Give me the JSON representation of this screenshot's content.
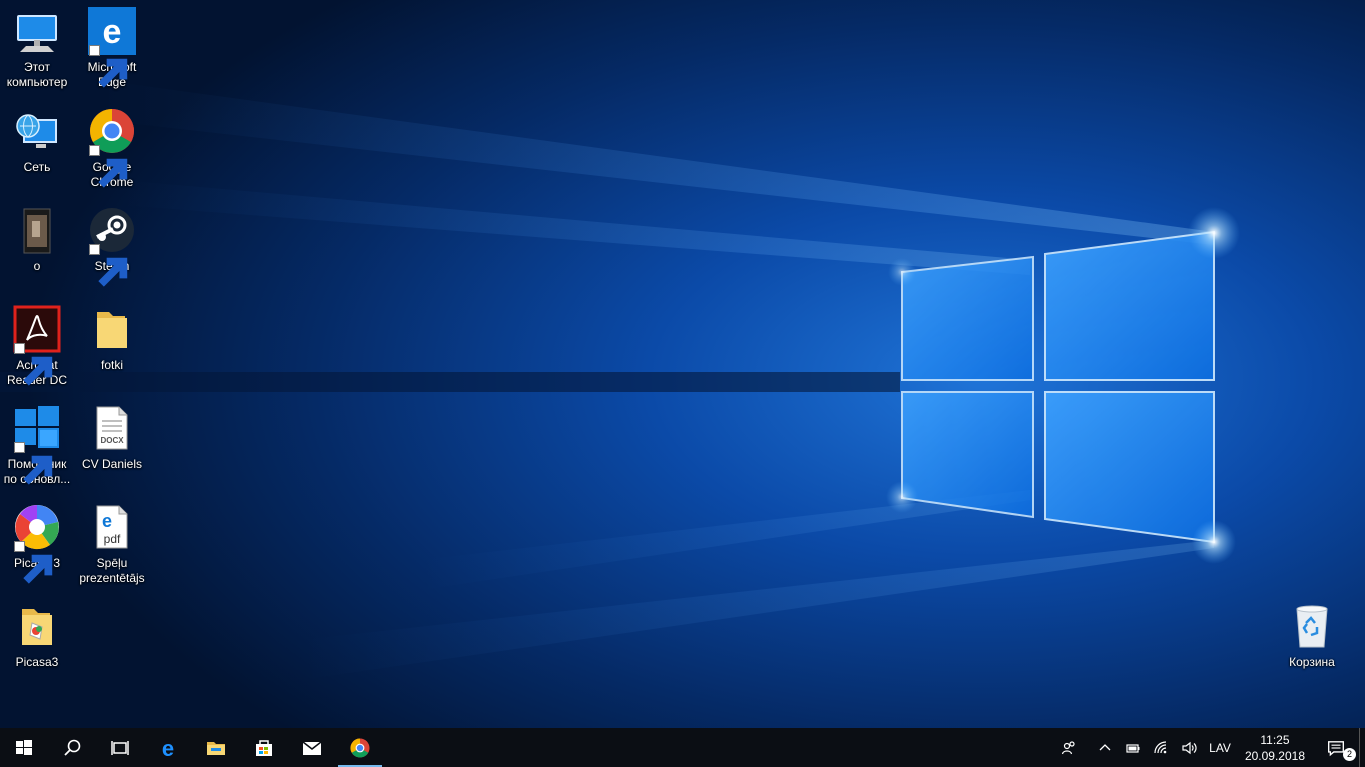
{
  "desktop": {
    "icons": [
      {
        "label": "Этот компьютер",
        "icon": "this-pc-icon",
        "shortcut": false
      },
      {
        "label": "Microsoft Edge",
        "icon": "edge-icon",
        "shortcut": true
      },
      {
        "label": "Сеть",
        "icon": "network-icon",
        "shortcut": false
      },
      {
        "label": "Google Chrome",
        "icon": "chrome-icon",
        "shortcut": true
      },
      {
        "label": "o",
        "icon": "video-file-icon",
        "shortcut": false
      },
      {
        "label": "Steam",
        "icon": "steam-icon",
        "shortcut": true
      },
      {
        "label": "Acrobat Reader DC",
        "icon": "acrobat-icon",
        "shortcut": true
      },
      {
        "label": "fotki",
        "icon": "folder-icon",
        "shortcut": false
      },
      {
        "label": "Помощник по обновл...",
        "icon": "windows-update-assistant-icon",
        "shortcut": true
      },
      {
        "label": "CV Daniels",
        "icon": "docx-file-icon",
        "shortcut": false
      },
      {
        "label": "Picasa 3",
        "icon": "picasa-icon",
        "shortcut": true
      },
      {
        "label": "Spēļu prezentētājs",
        "icon": "pdf-file-icon",
        "shortcut": false
      },
      {
        "label": "Picasa3",
        "icon": "picasa-folder-icon",
        "shortcut": false
      },
      {
        "label": "Корзина",
        "icon": "recycle-bin-icon",
        "shortcut": false
      }
    ]
  },
  "taskbar": {
    "buttons": [
      {
        "icon": "start-icon"
      },
      {
        "icon": "search-icon"
      },
      {
        "icon": "task-view-icon"
      },
      {
        "icon": "edge-icon"
      },
      {
        "icon": "file-explorer-icon"
      },
      {
        "icon": "store-icon"
      },
      {
        "icon": "mail-icon"
      },
      {
        "icon": "chrome-icon",
        "active": true
      }
    ],
    "tray": {
      "people_icon": "people-icon",
      "chevron_icon": "chevron-up-icon",
      "battery_icon": "battery-icon",
      "wifi_icon": "wifi-icon",
      "volume_icon": "volume-icon",
      "language": "LAV",
      "time": "11:25",
      "date": "20.09.2018",
      "notification_count": "2"
    }
  },
  "colors": {
    "taskbar": "#0b0e14",
    "accent": "#76b9ed",
    "wallpaper_dark": "#031a3d",
    "wallpaper_light": "#1a78e0"
  }
}
